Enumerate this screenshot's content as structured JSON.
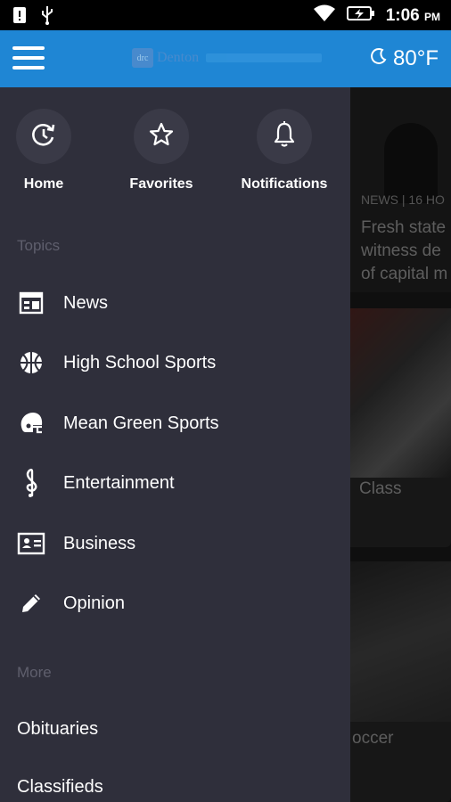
{
  "status_bar": {
    "time": "1:06",
    "ampm": "PM"
  },
  "app_bar": {
    "logo_badge": "drc",
    "logo_text": "Denton",
    "temperature": "80°F"
  },
  "drawer": {
    "quick_actions": [
      {
        "label": "Home",
        "icon": "home-refresh-icon"
      },
      {
        "label": "Favorites",
        "icon": "star-icon"
      },
      {
        "label": "Notifications",
        "icon": "bell-icon"
      }
    ],
    "topics_header": "Topics",
    "topics": [
      {
        "label": "News",
        "icon": "newspaper-icon"
      },
      {
        "label": "High School Sports",
        "icon": "basketball-icon"
      },
      {
        "label": "Mean Green Sports",
        "icon": "football-helmet-icon"
      },
      {
        "label": "Entertainment",
        "icon": "treble-clef-icon"
      },
      {
        "label": "Business",
        "icon": "id-card-icon"
      },
      {
        "label": "Opinion",
        "icon": "pencil-icon"
      }
    ],
    "more_header": "More",
    "more": [
      {
        "label": "Obituaries"
      },
      {
        "label": "Classifieds"
      }
    ]
  },
  "background_cards": [
    {
      "meta": "NEWS | 16 HO",
      "headline_lines": [
        "Fresh state",
        "witness de",
        "of capital m"
      ]
    },
    {
      "title": "Class"
    },
    {
      "title": "occer"
    }
  ]
}
